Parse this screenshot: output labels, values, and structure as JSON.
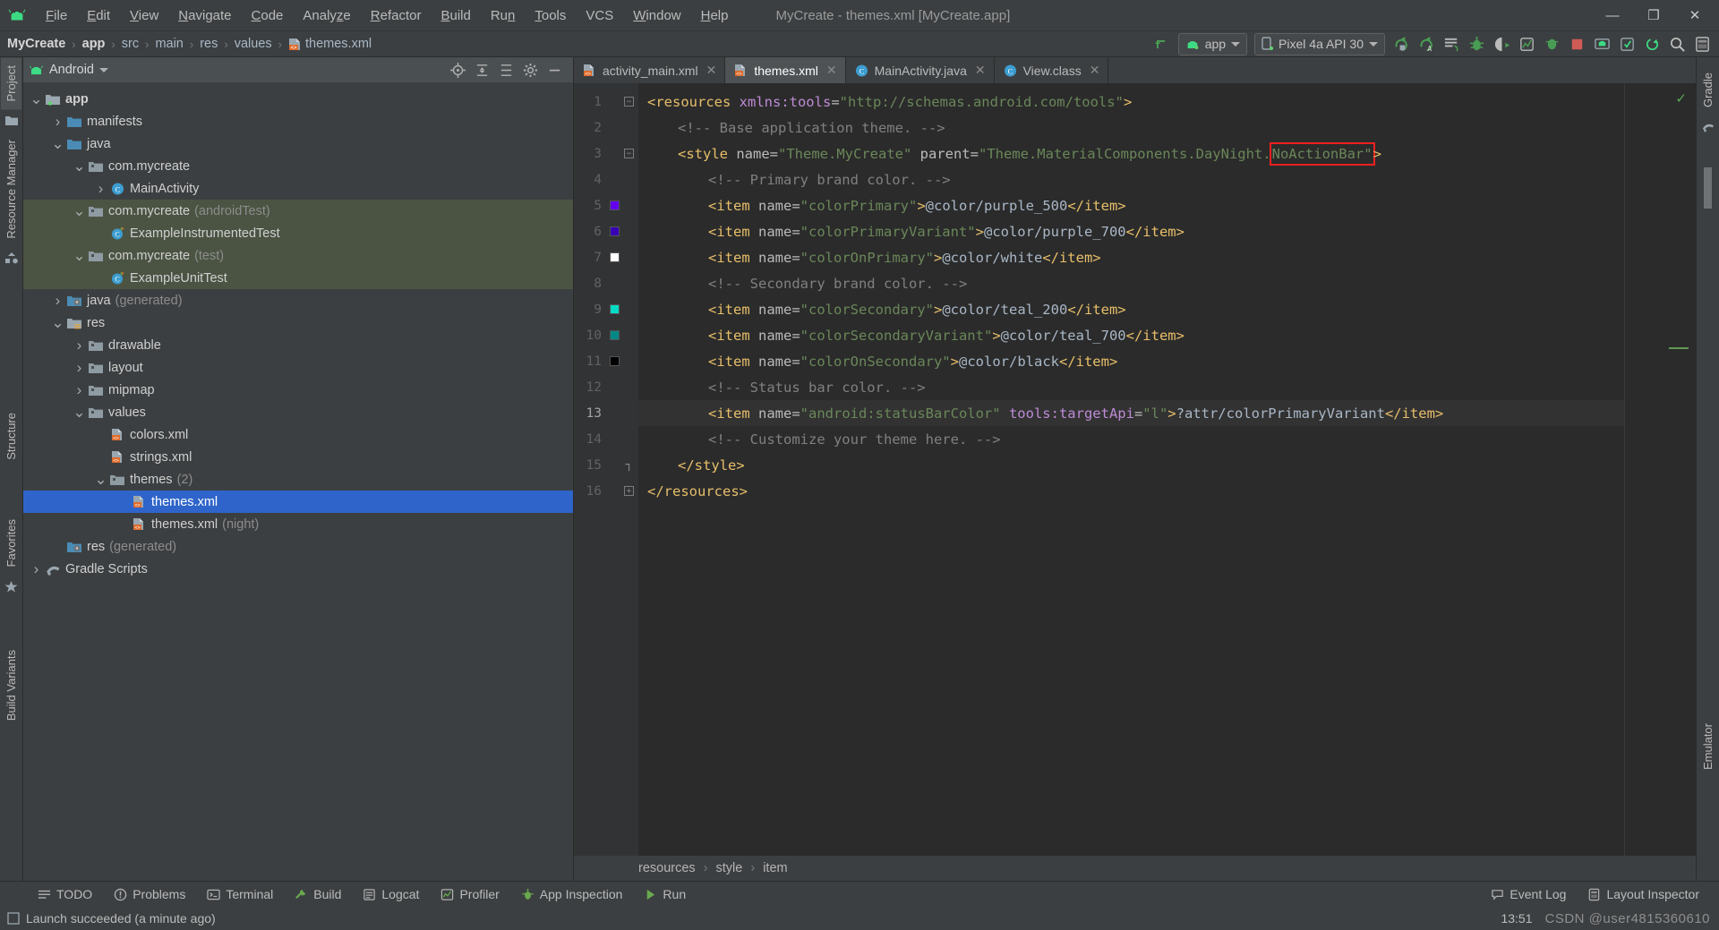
{
  "window": {
    "title": "MyCreate - themes.xml [MyCreate.app]",
    "minimize": "—",
    "maximize": "❐",
    "close": "✕"
  },
  "menu": {
    "items": [
      {
        "label": "File",
        "mnemonic": "F"
      },
      {
        "label": "Edit",
        "mnemonic": "E"
      },
      {
        "label": "View",
        "mnemonic": "V"
      },
      {
        "label": "Navigate",
        "mnemonic": "N"
      },
      {
        "label": "Code",
        "mnemonic": "C"
      },
      {
        "label": "Analyze",
        "mnemonic": "z"
      },
      {
        "label": "Refactor",
        "mnemonic": "R"
      },
      {
        "label": "Build",
        "mnemonic": "B"
      },
      {
        "label": "Run",
        "mnemonic": "n"
      },
      {
        "label": "Tools",
        "mnemonic": "T"
      },
      {
        "label": "VCS",
        "mnemonic": ""
      },
      {
        "label": "Window",
        "mnemonic": "W"
      },
      {
        "label": "Help",
        "mnemonic": "H"
      }
    ]
  },
  "breadcrumb": {
    "items": [
      "MyCreate",
      "app",
      "src",
      "main",
      "res",
      "values",
      "themes.xml"
    ],
    "separator": "›"
  },
  "toolbar": {
    "run_config": "app",
    "device": "Pixel 4a API 30",
    "icons": [
      "make-project-icon",
      "apply-changes-icon",
      "apply-code-changes-icon",
      "run-icon",
      "debug-icon",
      "run-with-coverage-icon",
      "profile-icon",
      "attach-debugger-icon",
      "stop-icon",
      "avd-manager-icon",
      "sdk-manager-icon",
      "sync-gradle-icon",
      "search-everywhere-icon",
      "layout-inspector-icon"
    ]
  },
  "left_strip": {
    "tabs": [
      "Project",
      "Resource Manager",
      "Structure",
      "Favorites",
      "Build Variants"
    ]
  },
  "right_strip": {
    "tabs": [
      "Gradle",
      "Emulator"
    ]
  },
  "project_pane": {
    "title": "Android",
    "dropdown_caret": "▾",
    "actions": [
      "target-icon",
      "collapse-all-icon",
      "expand-all-icon",
      "settings-icon",
      "hide-icon"
    ],
    "tree": [
      {
        "label": "app",
        "depth": 0,
        "arrow": "down",
        "icon": "module-folder-icon",
        "bold": true,
        "dim": "",
        "state": "normal"
      },
      {
        "label": "manifests",
        "depth": 1,
        "arrow": "right",
        "icon": "folder-icon",
        "bold": false,
        "dim": "",
        "state": "normal"
      },
      {
        "label": "java",
        "depth": 1,
        "arrow": "down",
        "icon": "folder-icon",
        "bold": false,
        "dim": "",
        "state": "normal"
      },
      {
        "label": "com.mycreate",
        "depth": 2,
        "arrow": "down",
        "icon": "package-icon",
        "bold": false,
        "dim": "",
        "state": "normal"
      },
      {
        "label": "MainActivity",
        "depth": 3,
        "arrow": "right",
        "icon": "class-icon",
        "bold": false,
        "dim": "",
        "state": "normal"
      },
      {
        "label": "com.mycreate",
        "depth": 2,
        "arrow": "down",
        "icon": "package-icon",
        "bold": false,
        "dim": "(androidTest)",
        "state": "testscope"
      },
      {
        "label": "ExampleInstrumentedTest",
        "depth": 3,
        "arrow": "none",
        "icon": "test-class-icon",
        "bold": false,
        "dim": "",
        "state": "testscope"
      },
      {
        "label": "com.mycreate",
        "depth": 2,
        "arrow": "down",
        "icon": "package-icon",
        "bold": false,
        "dim": "(test)",
        "state": "testscope"
      },
      {
        "label": "ExampleUnitTest",
        "depth": 3,
        "arrow": "none",
        "icon": "test-class-icon",
        "bold": false,
        "dim": "",
        "state": "testscope"
      },
      {
        "label": "java",
        "depth": 1,
        "arrow": "right",
        "icon": "generated-folder-icon",
        "bold": false,
        "dim": "(generated)",
        "state": "normal"
      },
      {
        "label": "res",
        "depth": 1,
        "arrow": "down",
        "icon": "res-folder-icon",
        "bold": false,
        "dim": "",
        "state": "normal"
      },
      {
        "label": "drawable",
        "depth": 2,
        "arrow": "right",
        "icon": "package-icon",
        "bold": false,
        "dim": "",
        "state": "normal"
      },
      {
        "label": "layout",
        "depth": 2,
        "arrow": "right",
        "icon": "package-icon",
        "bold": false,
        "dim": "",
        "state": "normal"
      },
      {
        "label": "mipmap",
        "depth": 2,
        "arrow": "right",
        "icon": "package-icon",
        "bold": false,
        "dim": "",
        "state": "normal"
      },
      {
        "label": "values",
        "depth": 2,
        "arrow": "down",
        "icon": "package-icon",
        "bold": false,
        "dim": "",
        "state": "normal"
      },
      {
        "label": "colors.xml",
        "depth": 3,
        "arrow": "none",
        "icon": "xml-file-icon",
        "bold": false,
        "dim": "",
        "state": "normal"
      },
      {
        "label": "strings.xml",
        "depth": 3,
        "arrow": "none",
        "icon": "xml-file-icon",
        "bold": false,
        "dim": "",
        "state": "normal"
      },
      {
        "label": "themes",
        "depth": 3,
        "arrow": "down",
        "icon": "package-icon",
        "bold": false,
        "dim": "(2)",
        "state": "normal"
      },
      {
        "label": "themes.xml",
        "depth": 4,
        "arrow": "none",
        "icon": "xml-file-icon",
        "bold": false,
        "dim": "",
        "state": "selected"
      },
      {
        "label": "themes.xml",
        "depth": 4,
        "arrow": "none",
        "icon": "xml-file-icon",
        "bold": false,
        "dim": "(night)",
        "state": "normal"
      },
      {
        "label": "res",
        "depth": 1,
        "arrow": "none",
        "icon": "generated-folder-icon",
        "bold": false,
        "dim": "(generated)",
        "state": "normal"
      },
      {
        "label": "Gradle Scripts",
        "depth": 0,
        "arrow": "right",
        "icon": "gradle-icon",
        "bold": false,
        "dim": "",
        "state": "normal"
      }
    ]
  },
  "editor": {
    "tabs": [
      {
        "label": "activity_main.xml",
        "icon": "xml-file-icon",
        "active": false,
        "close": "✕"
      },
      {
        "label": "themes.xml",
        "icon": "xml-file-icon",
        "active": true,
        "close": "✕"
      },
      {
        "label": "MainActivity.java",
        "icon": "java-class-icon",
        "active": false,
        "close": "✕"
      },
      {
        "label": "View.class",
        "icon": "java-class-icon",
        "active": false,
        "close": "✕"
      }
    ],
    "lines": [
      {
        "num": 1,
        "indent": 0,
        "swatch": "",
        "fold": "minus",
        "tokens": [
          {
            "t": "tag",
            "v": "<resources "
          },
          {
            "t": "ns",
            "v": "xmlns:tools"
          },
          {
            "t": "eq",
            "v": "="
          },
          {
            "t": "str",
            "v": "\"http://schemas.android.com/tools\""
          },
          {
            "t": "tag",
            "v": ">"
          }
        ]
      },
      {
        "num": 2,
        "indent": 1,
        "swatch": "",
        "fold": "",
        "tokens": [
          {
            "t": "cmt",
            "v": "<!-- Base application theme. -->"
          }
        ]
      },
      {
        "num": 3,
        "indent": 1,
        "swatch": "",
        "fold": "minus",
        "tokens": [
          {
            "t": "tag",
            "v": "<style "
          },
          {
            "t": "attr",
            "v": "name"
          },
          {
            "t": "eq",
            "v": "="
          },
          {
            "t": "str",
            "v": "\"Theme.MyCreate\""
          },
          {
            "t": "attr",
            "v": " parent"
          },
          {
            "t": "eq",
            "v": "="
          },
          {
            "t": "str",
            "v": "\"Theme.MaterialComponents.DayNight."
          },
          {
            "t": "str-boxed",
            "v": "NoActionBar\""
          },
          {
            "t": "tag",
            "v": ">"
          }
        ]
      },
      {
        "num": 4,
        "indent": 2,
        "swatch": "",
        "fold": "",
        "tokens": [
          {
            "t": "cmt",
            "v": "<!-- Primary brand color. -->"
          }
        ]
      },
      {
        "num": 5,
        "indent": 2,
        "swatch": "#6200EE",
        "fold": "",
        "tokens": [
          {
            "t": "tag",
            "v": "<item "
          },
          {
            "t": "attr",
            "v": "name"
          },
          {
            "t": "eq",
            "v": "="
          },
          {
            "t": "str",
            "v": "\"colorPrimary\""
          },
          {
            "t": "tag",
            "v": ">"
          },
          {
            "t": "txt",
            "v": "@color/purple_500"
          },
          {
            "t": "tag",
            "v": "</item>"
          }
        ]
      },
      {
        "num": 6,
        "indent": 2,
        "swatch": "#3700B3",
        "fold": "",
        "tokens": [
          {
            "t": "tag",
            "v": "<item "
          },
          {
            "t": "attr",
            "v": "name"
          },
          {
            "t": "eq",
            "v": "="
          },
          {
            "t": "str",
            "v": "\"colorPrimaryVariant\""
          },
          {
            "t": "tag",
            "v": ">"
          },
          {
            "t": "txt",
            "v": "@color/purple_700"
          },
          {
            "t": "tag",
            "v": "</item>"
          }
        ]
      },
      {
        "num": 7,
        "indent": 2,
        "swatch": "#FFFFFF",
        "fold": "",
        "tokens": [
          {
            "t": "tag",
            "v": "<item "
          },
          {
            "t": "attr",
            "v": "name"
          },
          {
            "t": "eq",
            "v": "="
          },
          {
            "t": "str",
            "v": "\"colorOnPrimary\""
          },
          {
            "t": "tag",
            "v": ">"
          },
          {
            "t": "txt",
            "v": "@color/white"
          },
          {
            "t": "tag",
            "v": "</item>"
          }
        ]
      },
      {
        "num": 8,
        "indent": 2,
        "swatch": "",
        "fold": "",
        "tokens": [
          {
            "t": "cmt",
            "v": "<!-- Secondary brand color. -->"
          }
        ]
      },
      {
        "num": 9,
        "indent": 2,
        "swatch": "#03DAC5",
        "fold": "",
        "tokens": [
          {
            "t": "tag",
            "v": "<item "
          },
          {
            "t": "attr",
            "v": "name"
          },
          {
            "t": "eq",
            "v": "="
          },
          {
            "t": "str",
            "v": "\"colorSecondary\""
          },
          {
            "t": "tag",
            "v": ">"
          },
          {
            "t": "txt",
            "v": "@color/teal_200"
          },
          {
            "t": "tag",
            "v": "</item>"
          }
        ]
      },
      {
        "num": 10,
        "indent": 2,
        "swatch": "#018786",
        "fold": "",
        "tokens": [
          {
            "t": "tag",
            "v": "<item "
          },
          {
            "t": "attr",
            "v": "name"
          },
          {
            "t": "eq",
            "v": "="
          },
          {
            "t": "str",
            "v": "\"colorSecondaryVariant\""
          },
          {
            "t": "tag",
            "v": ">"
          },
          {
            "t": "txt",
            "v": "@color/teal_700"
          },
          {
            "t": "tag",
            "v": "</item>"
          }
        ]
      },
      {
        "num": 11,
        "indent": 2,
        "swatch": "#000000",
        "fold": "",
        "tokens": [
          {
            "t": "tag",
            "v": "<item "
          },
          {
            "t": "attr",
            "v": "name"
          },
          {
            "t": "eq",
            "v": "="
          },
          {
            "t": "str",
            "v": "\"colorOnSecondary\""
          },
          {
            "t": "tag",
            "v": ">"
          },
          {
            "t": "txt",
            "v": "@color/black"
          },
          {
            "t": "tag",
            "v": "</item>"
          }
        ]
      },
      {
        "num": 12,
        "indent": 2,
        "swatch": "",
        "fold": "",
        "tokens": [
          {
            "t": "cmt",
            "v": "<!-- Status bar color. -->"
          }
        ]
      },
      {
        "num": 13,
        "indent": 2,
        "swatch": "",
        "fold": "",
        "highlight": true,
        "tokens": [
          {
            "t": "tag",
            "v": "<item "
          },
          {
            "t": "attr",
            "v": "name"
          },
          {
            "t": "eq",
            "v": "="
          },
          {
            "t": "str",
            "v": "\"android:statusBarColor\""
          },
          {
            "t": "ns",
            "v": " tools:targetApi"
          },
          {
            "t": "eq",
            "v": "="
          },
          {
            "t": "str",
            "v": "\"l\""
          },
          {
            "t": "tag",
            "v": ">"
          },
          {
            "t": "txt",
            "v": "?attr/colorPrimaryVariant"
          },
          {
            "t": "tag",
            "v": "</item>"
          }
        ]
      },
      {
        "num": 14,
        "indent": 2,
        "swatch": "",
        "fold": "",
        "tokens": [
          {
            "t": "cmt",
            "v": "<!-- Customize your theme here. -->"
          }
        ]
      },
      {
        "num": 15,
        "indent": 1,
        "swatch": "",
        "fold": "lock",
        "tokens": [
          {
            "t": "tag",
            "v": "</style>"
          }
        ]
      },
      {
        "num": 16,
        "indent": 0,
        "swatch": "",
        "fold": "plus",
        "tokens": [
          {
            "t": "tag",
            "v": "</resources>"
          }
        ]
      }
    ],
    "crumbs": [
      "resources",
      "style",
      "item"
    ],
    "crumb_sep": "›",
    "inspection_ok": "✓"
  },
  "bottom_toolbar": {
    "left": [
      {
        "label": "TODO",
        "icon": "todo-icon"
      },
      {
        "label": "Problems",
        "icon": "problems-icon"
      },
      {
        "label": "Terminal",
        "icon": "terminal-icon"
      },
      {
        "label": "Build",
        "icon": "build-icon"
      },
      {
        "label": "Logcat",
        "icon": "logcat-icon"
      },
      {
        "label": "Profiler",
        "icon": "profiler-icon"
      },
      {
        "label": "App Inspection",
        "icon": "app-inspection-icon"
      },
      {
        "label": "Run",
        "icon": "run-icon"
      }
    ],
    "right": [
      {
        "label": "Event Log",
        "icon": "event-log-icon"
      },
      {
        "label": "Layout Inspector",
        "icon": "layout-inspector-icon"
      }
    ]
  },
  "statusbar": {
    "message": "Launch succeeded (a minute ago)",
    "icon": "status-info-icon",
    "time": "13:51",
    "watermark": "CSDN @user4815360610"
  },
  "colors": {
    "accent_blue": "#2f65ca",
    "test_scope_green": "#4b5443",
    "editor_bg": "#2b2b2b",
    "panel_bg": "#3c3f41",
    "gutter_bg": "#313335",
    "annotation_red": "#f02020"
  }
}
